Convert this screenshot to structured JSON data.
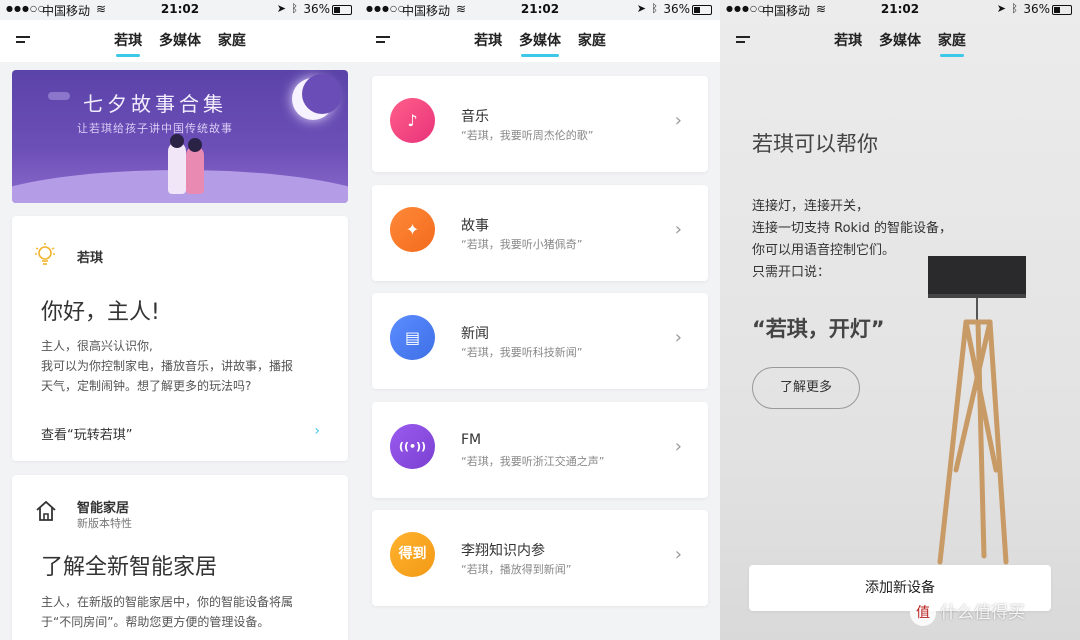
{
  "status": {
    "carrier": "中国移动",
    "time": "21:02",
    "battery": "36%"
  },
  "tabs": [
    "若琪",
    "多媒体",
    "家庭"
  ],
  "screen1": {
    "banner": {
      "title": "七夕故事合集",
      "subtitle": "让若琪给孩子讲中国传统故事"
    },
    "assistant_card": {
      "label": "若琪",
      "greeting": "你好，主人!",
      "body_lines": [
        "主人，很高兴认识你,",
        "我可以为你控制家电，播放音乐，讲故事，播报",
        "天气，定制闹钟。想了解更多的玩法吗?"
      ],
      "link": "查看“玩转若琪”",
      "chevron": "›"
    },
    "smarthome_card": {
      "title": "智能家居",
      "subtitle": "新版本特性",
      "headline": "了解全新智能家居",
      "body_lines": [
        "主人，在新版的智能家居中，你的智能设备将属",
        "于“不同房间”。帮助您更方便的管理设备。"
      ]
    }
  },
  "screen2": {
    "items": [
      {
        "title": "音乐",
        "subtitle": "“若琪，我要听周杰伦的歌”",
        "icon": "♪",
        "color": "#f0407a"
      },
      {
        "title": "故事",
        "subtitle": "“若琪，我要听小猪佩奇”",
        "icon": "✦",
        "color": "#f67a2a"
      },
      {
        "title": "新闻",
        "subtitle": "“若琪，我要听科技新闻”",
        "icon": "▤",
        "color": "#4a7df0"
      },
      {
        "title": "FM",
        "subtitle": "“若琪，我要听浙江交通之声”",
        "icon": "((•))",
        "color": "#8a4fd6"
      },
      {
        "title": "李翔知识内参",
        "subtitle": "“若琪，播放得到新闻”",
        "icon": "得到",
        "color": "#f6a21f"
      }
    ],
    "chevron": "›"
  },
  "screen3": {
    "title": "若琪可以帮你",
    "body_lines": [
      "连接灯，连接开关，",
      "连接一切支持 Rokid 的智能设备，",
      "你可以用语音控制它们。",
      "只需开口说："
    ],
    "quote": "“若琪，开灯”",
    "learn_more": "了解更多",
    "add_device": "添加新设备",
    "watermark_badge": "值",
    "watermark": "什么值得买"
  }
}
